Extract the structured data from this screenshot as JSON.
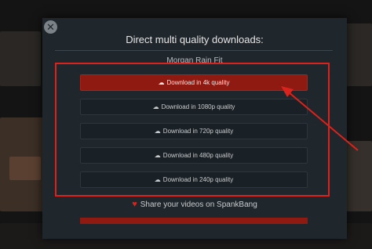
{
  "modal": {
    "close_symbol": "✕",
    "title": "Direct multi quality downloads:",
    "video_title": "Morgan Rain Fit"
  },
  "downloads": [
    {
      "label": "Download in 4k quality",
      "icon": "cloud-download-icon",
      "highlighted": true
    },
    {
      "label": "Download in 1080p quality",
      "icon": "cloud-download-icon"
    },
    {
      "label": "Download in 720p quality",
      "icon": "cloud-download-icon"
    },
    {
      "label": "Download in 480p quality",
      "icon": "cloud-download-icon"
    },
    {
      "label": "Download in 240p quality",
      "icon": "cloud-download-icon"
    }
  ],
  "share": {
    "icon": "heart-icon",
    "label": "Share your videos on SpankBang"
  },
  "colors": {
    "accent_red": "#8e1a12",
    "annotation_red": "#d9231c",
    "modal_bg": "#1f262c"
  }
}
